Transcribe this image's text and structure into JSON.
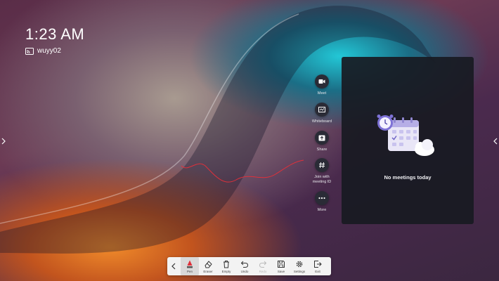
{
  "clock": {
    "time": "1:23 AM"
  },
  "user": {
    "name": "wuyy02",
    "icon": "cast-screen-icon"
  },
  "rail": {
    "items": [
      {
        "label": "Meet",
        "icon": "video-camera-icon"
      },
      {
        "label": "Whiteboard",
        "icon": "whiteboard-icon"
      },
      {
        "label": "Share",
        "icon": "share-screen-icon"
      },
      {
        "label": "Join with meeting ID",
        "icon": "hash-icon"
      },
      {
        "label": "More",
        "icon": "more-dots-icon"
      }
    ]
  },
  "meetings_panel": {
    "empty_text": "No meetings today",
    "illustration": "calendar-clock-cloud-illustration"
  },
  "toolbar": {
    "collapse_icon": "chevron-left-icon",
    "items": [
      {
        "label": "Pen",
        "icon": "pen-icon",
        "state": "active"
      },
      {
        "label": "Eraser",
        "icon": "eraser-icon",
        "state": "normal"
      },
      {
        "label": "Empty",
        "icon": "trash-icon",
        "state": "normal"
      },
      {
        "label": "Undo",
        "icon": "undo-icon",
        "state": "normal"
      },
      {
        "label": "Redo",
        "icon": "redo-icon",
        "state": "disabled"
      },
      {
        "label": "Save",
        "icon": "save-icon",
        "state": "normal"
      },
      {
        "label": "Settings",
        "icon": "gear-icon",
        "state": "normal"
      },
      {
        "label": "Exit",
        "icon": "exit-icon",
        "state": "normal"
      }
    ]
  },
  "colors": {
    "ink": "#e0303a",
    "accent_teal": "#22c7d6",
    "accent_orange": "#f08a2a",
    "panel": "#181a22"
  }
}
